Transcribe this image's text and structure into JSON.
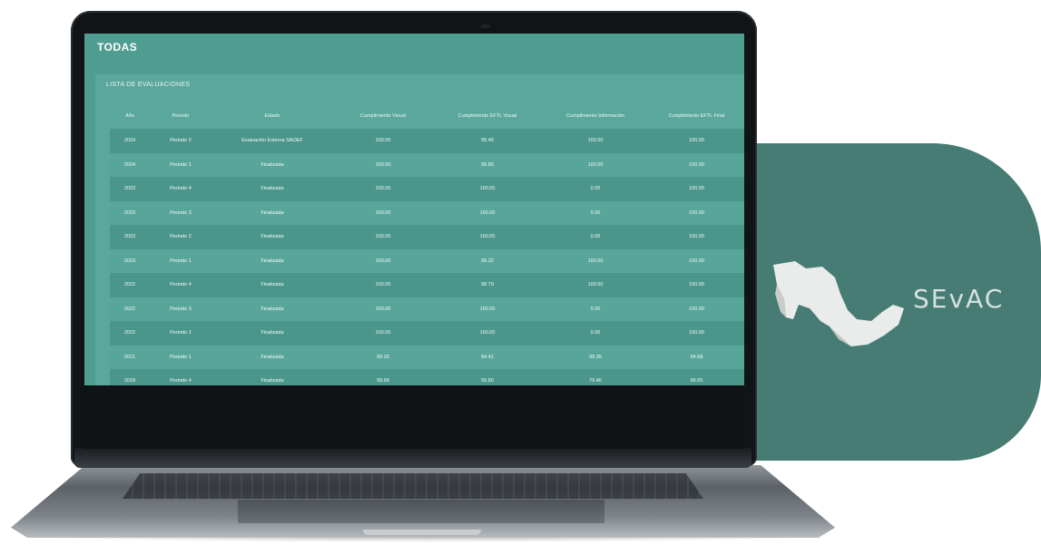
{
  "screen": {
    "title": "TODAS",
    "panel_title": "LISTA DE EVALUACIONES",
    "columns": [
      "Año",
      "Periodo",
      "Estado",
      "Cumplimiento Visual",
      "Cumplimiento EFTL Visual",
      "Cumplimiento Información",
      "Cumplimiento EFTL Final"
    ],
    "rows": [
      [
        "2024",
        "Periodo 2",
        "Evaluación Externa SAOEF",
        "100.00",
        "99.49",
        "100.00",
        "100.00"
      ],
      [
        "2024",
        "Periodo 1",
        "Finalizada",
        "100.00",
        "99.80",
        "100.00",
        "100.00"
      ],
      [
        "2023",
        "Periodo 4",
        "Finalizada",
        "100.00",
        "100.00",
        "0.00",
        "100.00"
      ],
      [
        "2023",
        "Periodo 3",
        "Finalizada",
        "100.00",
        "100.00",
        "0.00",
        "100.00"
      ],
      [
        "2023",
        "Periodo 2",
        "Finalizada",
        "100.00",
        "100.00",
        "0.00",
        "100.00"
      ],
      [
        "2023",
        "Periodo 1",
        "Finalizada",
        "100.00",
        "99.32",
        "100.00",
        "100.00"
      ],
      [
        "2022",
        "Periodo 4",
        "Finalizada",
        "100.00",
        "98.79",
        "100.00",
        "100.00"
      ],
      [
        "2022",
        "Periodo 3",
        "Finalizada",
        "100.00",
        "100.00",
        "0.00",
        "100.00"
      ],
      [
        "2022",
        "Periodo 1",
        "Finalizada",
        "100.00",
        "100.00",
        "0.00",
        "100.00"
      ],
      [
        "2021",
        "Periodo 1",
        "Finalizada",
        "99.33",
        "94.41",
        "99.35",
        "94.68"
      ],
      [
        "2018",
        "Periodo 4",
        "Finalizada",
        "99.68",
        "99.80",
        "79.46",
        "99.65"
      ]
    ]
  },
  "brand": {
    "logo_text": "SEvAC",
    "colors": {
      "card": "#467c74",
      "screen": "#4f9c90"
    },
    "map_icon": "mexico-map-icon"
  }
}
